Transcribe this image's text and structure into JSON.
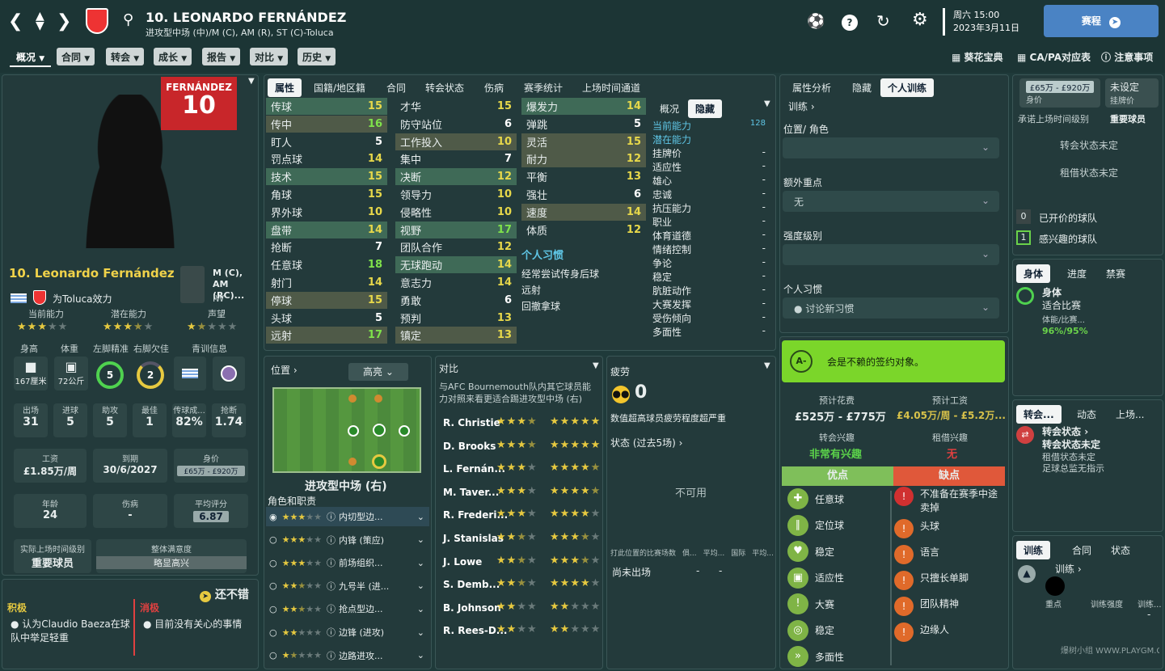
{
  "header": {
    "player_title": "10. LEONARDO FERNÁNDEZ",
    "positions_line": "进攻型中场 (中)/M (C), AM (R), ST (C)-Toluca",
    "datetime_line1": "周六 15:00",
    "datetime_line2": "2023年3月11日",
    "match_button": "赛程"
  },
  "nav": {
    "items": [
      "概况",
      "合同",
      "转会",
      "成长",
      "报告",
      "对比",
      "历史"
    ]
  },
  "top_links": {
    "guide": "葵花宝典",
    "capa": "CA/PA对应表",
    "notes": "注意事项"
  },
  "profile": {
    "shirt_name": "FERNÁNDEZ",
    "shirt_number": "10",
    "name": "10. Leonardo Fernández",
    "club_text": "为Toluca效力",
    "positions": "M (C), AM (RC)...",
    "pos_sub": "IW",
    "ratings": {
      "ca_label": "当前能力",
      "pa_label": "潜在能力",
      "rep_label": "声望",
      "ca_stars": 3,
      "pa_stars": 3.5,
      "rep_stars": 1.5
    },
    "phys_labels": [
      "身高",
      "体重",
      "左脚精准",
      "右脚欠佳",
      "青训信息"
    ],
    "height": "167厘米",
    "weight": "72公斤",
    "left_foot": "5",
    "right_foot": "2",
    "stats": [
      {
        "label": "出场",
        "value": "31"
      },
      {
        "label": "进球",
        "value": "5"
      },
      {
        "label": "助攻",
        "value": "5"
      },
      {
        "label": "最佳",
        "value": "1"
      },
      {
        "label": "传球成...",
        "value": "82%"
      },
      {
        "label": "抢断",
        "value": "1.74"
      }
    ],
    "wage_label": "工资",
    "wage": "£1.85万/周",
    "expires_label": "到期",
    "expires": "30/6/2027",
    "value_label": "身价",
    "value": "£65万 - £920万",
    "age_label": "年龄",
    "age": "24",
    "injury_label": "伤病",
    "injury": "-",
    "avg_label": "平均评分",
    "avg": "6.87",
    "playtime_label": "实际上场时间级别",
    "playtime": "重要球员",
    "morale_label": "整体满意度",
    "morale": "略显高兴"
  },
  "feedback": {
    "status": "还不错",
    "pos_title": "积极",
    "pos_text": "认为Claudio Baeza在球队中举足轻重",
    "neg_title": "消极",
    "neg_text": "目前没有关心的事情"
  },
  "attr_tabs": [
    "属性",
    "国籍/地区籍",
    "合同",
    "转会状态",
    "伤病",
    "赛季统计",
    "上场时间通道"
  ],
  "attributes": {
    "col1": [
      {
        "n": "传球",
        "v": "15",
        "h": 1
      },
      {
        "n": "传中",
        "v": "16",
        "h": 2
      },
      {
        "n": "盯人",
        "v": "5",
        "h": 0
      },
      {
        "n": "罚点球",
        "v": "14",
        "h": 0
      },
      {
        "n": "技术",
        "v": "15",
        "h": 1
      },
      {
        "n": "角球",
        "v": "15",
        "h": 0
      },
      {
        "n": "界外球",
        "v": "10",
        "h": 0
      },
      {
        "n": "盘带",
        "v": "14",
        "h": 1
      },
      {
        "n": "抢断",
        "v": "7",
        "h": 0
      },
      {
        "n": "任意球",
        "v": "18",
        "h": 0
      },
      {
        "n": "射门",
        "v": "14",
        "h": 0
      },
      {
        "n": "停球",
        "v": "15",
        "h": 2
      },
      {
        "n": "头球",
        "v": "5",
        "h": 0
      },
      {
        "n": "远射",
        "v": "17",
        "h": 2
      }
    ],
    "col2": [
      {
        "n": "才华",
        "v": "15",
        "h": 0
      },
      {
        "n": "防守站位",
        "v": "6",
        "h": 0
      },
      {
        "n": "工作投入",
        "v": "10",
        "h": 2
      },
      {
        "n": "集中",
        "v": "7",
        "h": 0
      },
      {
        "n": "决断",
        "v": "12",
        "h": 1
      },
      {
        "n": "领导力",
        "v": "10",
        "h": 0
      },
      {
        "n": "侵略性",
        "v": "10",
        "h": 0
      },
      {
        "n": "视野",
        "v": "17",
        "h": 1
      },
      {
        "n": "团队合作",
        "v": "12",
        "h": 0
      },
      {
        "n": "无球跑动",
        "v": "14",
        "h": 1
      },
      {
        "n": "意志力",
        "v": "14",
        "h": 0
      },
      {
        "n": "勇敢",
        "v": "6",
        "h": 0
      },
      {
        "n": "预判",
        "v": "13",
        "h": 0
      },
      {
        "n": "镇定",
        "v": "13",
        "h": 2
      }
    ],
    "col3": [
      {
        "n": "爆发力",
        "v": "14",
        "h": 1
      },
      {
        "n": "弹跳",
        "v": "5",
        "h": 0
      },
      {
        "n": "灵活",
        "v": "15",
        "h": 2
      },
      {
        "n": "耐力",
        "v": "12",
        "h": 2
      },
      {
        "n": "平衡",
        "v": "13",
        "h": 0
      },
      {
        "n": "强壮",
        "v": "6",
        "h": 0
      },
      {
        "n": "速度",
        "v": "14",
        "h": 2
      },
      {
        "n": "体质",
        "v": "12",
        "h": 0
      }
    ]
  },
  "traits": {
    "title": "个人习惯",
    "items": [
      "经常尝试传身后球",
      "远射",
      "回撤拿球"
    ]
  },
  "hidden": {
    "tabs": [
      "概况",
      "隐藏"
    ],
    "rows": [
      {
        "n": "当前能力",
        "v": "128"
      },
      {
        "n": "潜在能力",
        "v": ""
      },
      {
        "n": "挂牌价",
        "v": "-"
      },
      {
        "n": "适应性",
        "v": "-"
      },
      {
        "n": "雄心",
        "v": "-"
      },
      {
        "n": "忠诚",
        "v": "-"
      },
      {
        "n": "抗压能力",
        "v": "-"
      },
      {
        "n": "职业",
        "v": "-"
      },
      {
        "n": "体育道德",
        "v": "-"
      },
      {
        "n": "情绪控制",
        "v": "-"
      },
      {
        "n": "争论",
        "v": "-"
      },
      {
        "n": "稳定",
        "v": "-"
      },
      {
        "n": "肮脏动作",
        "v": "-"
      },
      {
        "n": "大赛发挥",
        "v": "-"
      },
      {
        "n": "受伤倾向",
        "v": "-"
      },
      {
        "n": "多面性",
        "v": "-"
      }
    ]
  },
  "position_panel": {
    "title": "位置",
    "highlight": "高亮",
    "role_name": "进攻型中场 (右)",
    "roles_title": "角色和职责",
    "roles": [
      {
        "name": "内切型边...",
        "stars": 3
      },
      {
        "name": "内锋 (策应)",
        "stars": 3
      },
      {
        "name": "前场组织...",
        "stars": 3
      },
      {
        "name": "九号半 (进...",
        "stars": 2.5
      },
      {
        "name": "抢点型边...",
        "stars": 2.5
      },
      {
        "name": "边锋 (进攻)",
        "stars": 2
      },
      {
        "name": "边路进攻...",
        "stars": 1.5
      }
    ]
  },
  "compare": {
    "title": "对比",
    "desc": "与AFC Bournemouth队内其它球员能力对照来看更适合踢进攻型中场 (右)",
    "rows": [
      {
        "n": "R. Christie",
        "a": 3.5,
        "b": 5
      },
      {
        "n": "D. Brooks",
        "a": 3.5,
        "b": 5
      },
      {
        "n": "L. Fernán...",
        "a": 3,
        "b": 4.5
      },
      {
        "n": "M. Taver...",
        "a": 3,
        "b": 4.5
      },
      {
        "n": "R. Frederi...",
        "a": 3,
        "b": 4
      },
      {
        "n": "J. Stanislas",
        "a": 2.5,
        "b": 3.5
      },
      {
        "n": "J. Lowe",
        "a": 2.5,
        "b": 3.5
      },
      {
        "n": "S. Demb...",
        "a": 2.5,
        "b": 4
      },
      {
        "n": "B. Johnson",
        "a": 2,
        "b": 2
      },
      {
        "n": "R. Rees-D...",
        "a": 2,
        "b": 2
      }
    ]
  },
  "fatigue": {
    "title": "疲劳",
    "value": "0",
    "desc": "数值超高球员疲劳程度超严重",
    "form_title": "状态 (过去5场)",
    "unavailable": "不可用",
    "cols": [
      "打此位置的比赛场数",
      "俱...",
      "平均...",
      "国际",
      "平均..."
    ],
    "row_label": "尚未出场",
    "row_v1": "-",
    "row_v2": "-"
  },
  "training": {
    "tabs": [
      "属性分析",
      "隐藏",
      "个人训练"
    ],
    "link": "训练",
    "pos_label": "位置/ 角色",
    "focus_label": "额外重点",
    "focus_value": "无",
    "intensity_label": "强度级别",
    "trait_label": "个人习惯",
    "trait_value": "讨论新习惯"
  },
  "scout": {
    "grade": "A-",
    "verdict": "会是不赖的签约对象。",
    "cost_label": "预计花费",
    "cost": "£525万 - £775万",
    "wage_label": "预计工资",
    "wage": "£4.05万/周 - £5.2万...",
    "interest_label": "转会兴趣",
    "interest": "非常有兴趣",
    "loan_label": "租借兴趣",
    "loan": "无",
    "pros_title": "优点",
    "cons_title": "缺点",
    "pros": [
      "任意球",
      "定位球",
      "稳定",
      "适应性",
      "大赛",
      "稳定",
      "多面性"
    ],
    "cons": [
      "不准备在赛季中途卖掉",
      "头球",
      "语言",
      "只擅长单脚",
      "团队精神",
      "边缘人"
    ]
  },
  "right": {
    "value": "£65万 - £920万",
    "value_label": "身价",
    "listing": "未设定",
    "listing_label": "挂牌价",
    "promise_label": "承诺上场时间级别",
    "promise": "重要球员",
    "transfer_status": "转会状态未定",
    "loan_status": "租借状态未定",
    "bid_count": "0",
    "bid_label": "已开价的球队",
    "interest_count": "1",
    "interest_label": "感兴趣的球队",
    "phys_tabs": [
      "身体",
      "进度",
      "禁赛"
    ],
    "phys_title": "身体",
    "phys_state": "适合比赛",
    "phys_sub": "体能/比赛...",
    "phys_val": "96%/95%",
    "tr_tabs": [
      "转会...",
      "动态",
      "上场..."
    ],
    "tr_title": "转会状态",
    "tr_state": "转会状态未定",
    "tr_loan": "租借状态未定",
    "tr_note": "足球总监无指示",
    "train_tabs": [
      "训练",
      "合同",
      "状态"
    ],
    "train_title": "训练",
    "train_col1": "重点",
    "train_col2": "训练强度",
    "train_col3": "训练...",
    "train_dash": "-"
  },
  "watermark": "爆树小组 WWW.PLAYGM.CC"
}
